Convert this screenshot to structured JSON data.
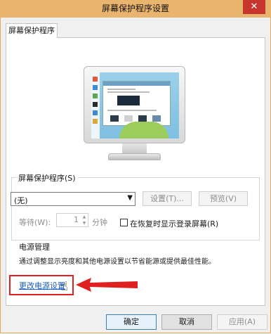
{
  "window": {
    "title": "屏幕保护程序设置",
    "close_label": "✕"
  },
  "tab": {
    "label": "屏幕保护程序"
  },
  "screensaver": {
    "group_label": "屏幕保护程序(S)",
    "selected": "(无)",
    "settings_button": "设置(T)...",
    "preview_button": "预览(V)",
    "wait_label": "等待(W):",
    "wait_value": "1",
    "wait_unit": "分钟",
    "resume_checkbox_label": "在恢复时显示登录屏幕(R)",
    "resume_checked": false
  },
  "power": {
    "title": "电源管理",
    "description": "通过调整显示亮度和其他电源设置以节省能源或提供最佳性能。",
    "link": "更改电源设置"
  },
  "footer": {
    "ok": "确定",
    "cancel": "取消",
    "apply": "应用(A)"
  },
  "colors": {
    "titlebar": "#e9b46d",
    "close": "#c7362d",
    "link": "#1a5dc0",
    "annotation": "#e02020"
  }
}
